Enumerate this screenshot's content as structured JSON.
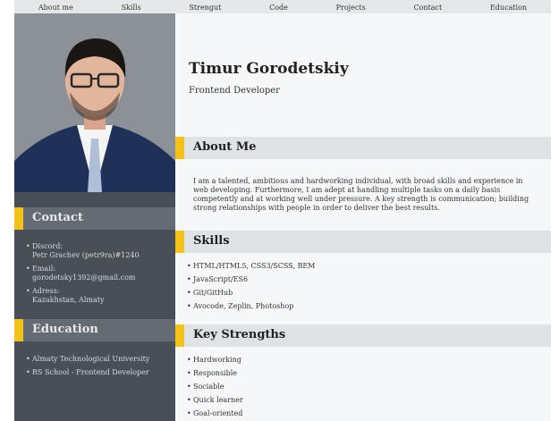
{
  "nav": {
    "items": [
      "About me",
      "Skills",
      "Strengut",
      "Code",
      "Projects",
      "Contact",
      "Education"
    ]
  },
  "profile": {
    "name": "Timur Gorodetskiy",
    "role": "Frontend Developer",
    "photo_alt": "avatar"
  },
  "sidebar": {
    "contact": {
      "title": "Contact",
      "items": [
        {
          "label": "Discord:",
          "value": "Petr Grachev (petr9ra)#1240"
        },
        {
          "label": "Email:",
          "value": "gorodetsky1392@gmail.com"
        },
        {
          "label": "Adress:",
          "value": "Kazakhstan, Almaty"
        }
      ]
    },
    "education": {
      "title": "Education",
      "items": [
        "Almaty Technological University",
        "RS School - Frontend Developer"
      ]
    }
  },
  "main": {
    "about": {
      "title": "About Me",
      "text": "I am a talented, ambitious and hardworking individual, with broad skills and experience in web developing. Furthermore, I am adept at handling multiple tasks on a daily basis competently and at working well under pressure. A key strength is communication; building strong relationships with people in order to deliver the best results."
    },
    "skills": {
      "title": "Skills",
      "items": [
        "HTML/HTML5, CSS3/SCSS, BEM",
        "JavaScript/ES6",
        "Git/GitHub",
        "Avocode, Zeplin, Photoshop"
      ]
    },
    "strengths": {
      "title": "Key Strengths",
      "items": [
        "Hardworking",
        "Responsible",
        "Sociable",
        "Quick learner",
        "Goal-oriented"
      ]
    }
  },
  "colors": {
    "accent": "#f2c21a",
    "sidebar_bg": "#494e57",
    "sidebar_head_bg": "#656b73",
    "main_bg": "#f6f7f8",
    "section_head_bg": "#e0e2e5"
  }
}
